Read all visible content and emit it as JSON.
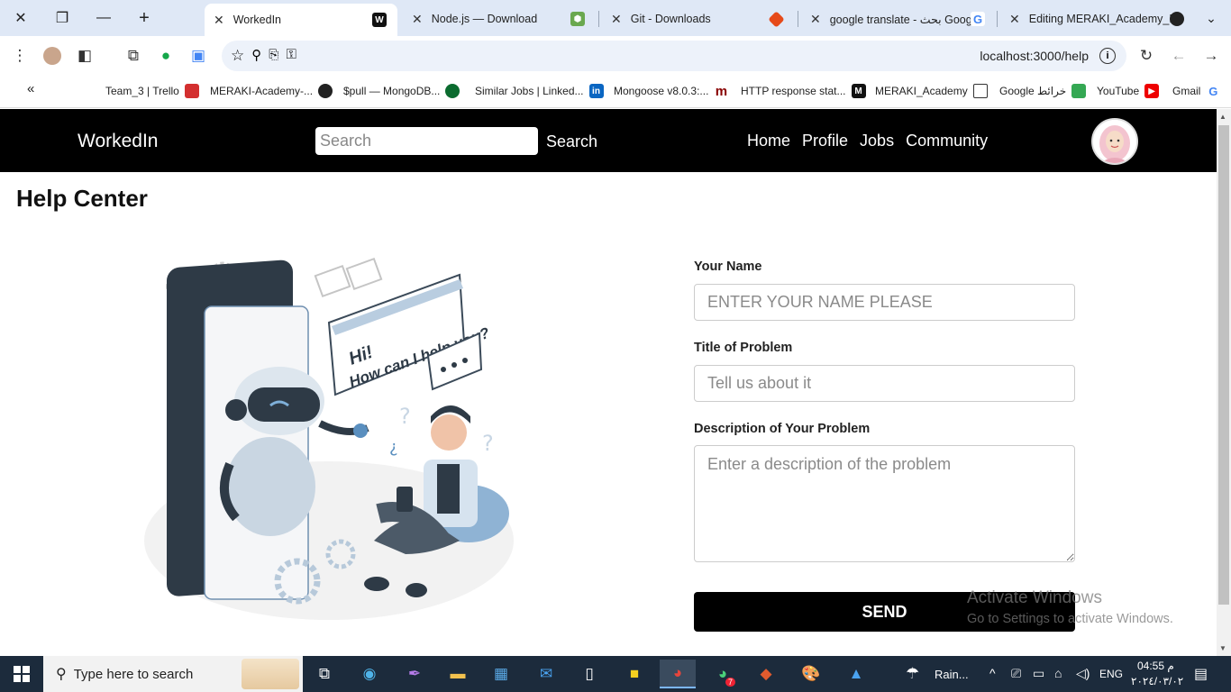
{
  "browser": {
    "tabs": [
      {
        "label": "WorkedIn",
        "active": true
      },
      {
        "label": "Node.js — Download",
        "active": false
      },
      {
        "label": "Git - Downloads",
        "active": false
      },
      {
        "label": "google translate - بحث Goog",
        "active": false
      },
      {
        "label": "Editing MERAKI_Academy_P",
        "active": false
      }
    ],
    "url": "localhost:3000/help",
    "bookmarks": [
      "Team_3 | Trello",
      "MERAKI-Academy-...",
      "$pull — MongoDB...",
      "Similar Jobs | Linked...",
      "Mongoose v8.0.3:...",
      "HTTP response stat...",
      "MERAKI_Academy",
      "Google خرائط",
      "YouTube",
      "Gmail"
    ]
  },
  "navbar": {
    "brand": "WorkedIn",
    "search_placeholder": "Search",
    "search_label": "Search",
    "links": [
      "Home",
      "Profile",
      "Jobs",
      "Community"
    ]
  },
  "page": {
    "title": "Help Center",
    "illustration": {
      "speech_line1": "Hi!",
      "speech_line2": "How can I help you?"
    },
    "form": {
      "name_label": "Your Name",
      "name_placeholder": "ENTER YOUR NAME PLEASE",
      "title_label": "Title of Problem",
      "title_placeholder": "Tell us about it",
      "description_label": "Description of Your Problem",
      "description_placeholder": "Enter a description of the problem",
      "send_label": "SEND"
    }
  },
  "watermark": {
    "line1": "Activate Windows",
    "line2": "Go to Settings to activate Windows."
  },
  "taskbar": {
    "search_placeholder": "Type here to search",
    "weather": "Rain...",
    "language": "ENG",
    "time": "04:55 م",
    "date": "٢٠٢٤/٠٣/٠٢",
    "notification_badge": "7"
  }
}
